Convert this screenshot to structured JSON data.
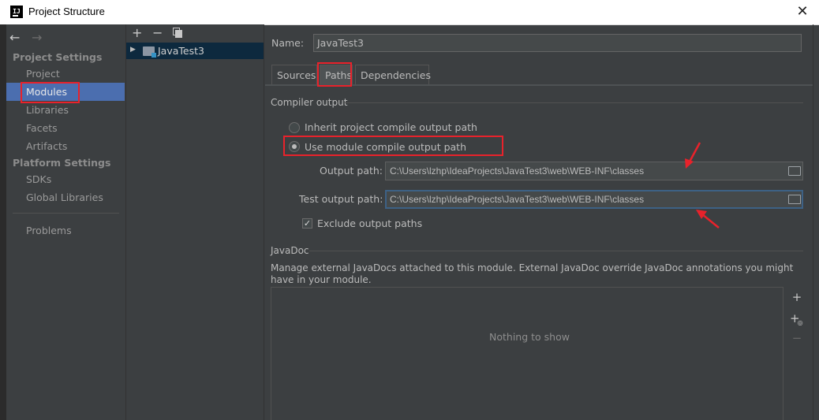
{
  "window": {
    "title": "Project Structure",
    "app_icon": "intellij-icon",
    "close_glyph": "✕"
  },
  "sidebar": {
    "back_arrow": "←",
    "forward_arrow": "→",
    "project_settings_header": "Project Settings",
    "platform_settings_header": "Platform Settings",
    "items": [
      {
        "label": "Project"
      },
      {
        "label": "Modules",
        "selected": true
      },
      {
        "label": "Libraries"
      },
      {
        "label": "Facets"
      },
      {
        "label": "Artifacts"
      },
      {
        "label": "SDKs"
      },
      {
        "label": "Global Libraries"
      },
      {
        "label": "Problems"
      }
    ]
  },
  "module_tree": {
    "toolbar": {
      "add": "+",
      "remove": "−",
      "copy_icon": "copy-icon"
    },
    "modules": [
      {
        "label": "JavaTest3",
        "expand_glyph": "▶"
      }
    ]
  },
  "details": {
    "name_label": "Name:",
    "name_value": "JavaTest3",
    "tabs": [
      {
        "label": "Sources"
      },
      {
        "label": "Paths",
        "active": true
      },
      {
        "label": "Dependencies"
      }
    ],
    "compiler_output": {
      "section_title": "Compiler output",
      "option_inherit": "Inherit project compile output path",
      "option_module": "Use module compile output path",
      "selected_option": "Use module compile output path",
      "output_path_label": "Output path:",
      "output_path_value": "C:\\Users\\lzhp\\IdeaProjects\\JavaTest3\\web\\WEB-INF\\classes",
      "test_output_path_label": "Test output path:",
      "test_output_path_value": "C:\\Users\\lzhp\\IdeaProjects\\JavaTest3\\web\\WEB-INF\\classes",
      "exclude_label": "Exclude output paths",
      "exclude_checked": true,
      "check_glyph": "✓"
    },
    "javadoc": {
      "section_title": "JavaDoc",
      "description": "Manage external JavaDocs attached to this module. External JavaDoc override JavaDoc annotations you might have in your module.",
      "empty_text": "Nothing to show",
      "add_glyph": "+",
      "add_url_glyph": "+",
      "remove_glyph": "−"
    }
  },
  "annotation_color": "#e8222b",
  "selection_color": "#4b6eaf"
}
